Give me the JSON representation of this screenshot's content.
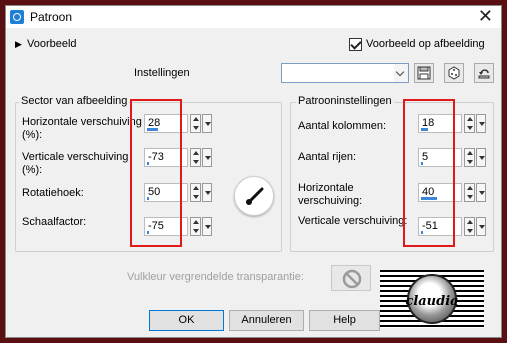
{
  "window": {
    "title": "Patroon"
  },
  "preview": {
    "label": "Voorbeeld",
    "checkbox_label": "Voorbeeld op afbeelding",
    "checked": true
  },
  "settings": {
    "label": "Instellingen",
    "preset_value": ""
  },
  "sector": {
    "title": "Sector van afbeelding",
    "fields": [
      {
        "label": "Horizontale verschuiving (%):",
        "value": "28",
        "level": 28
      },
      {
        "label": "Verticale verschuiving (%):",
        "value": "-73",
        "level": 5
      },
      {
        "label": "Rotatiehoek:",
        "value": "50",
        "level": 5
      },
      {
        "label": "Schaalfactor:",
        "value": "-75",
        "level": 5
      }
    ]
  },
  "pattern": {
    "title": "Patrooninstellingen",
    "fields": [
      {
        "label": "Aantal kolommen:",
        "value": "18",
        "level": 18
      },
      {
        "label": "Aantal rijen:",
        "value": "5",
        "level": 5
      },
      {
        "label": "Horizontale verschuiving:",
        "value": "40",
        "level": 40
      },
      {
        "label": "Verticale verschuiving:",
        "value": "-51",
        "level": 5
      }
    ]
  },
  "transparency": {
    "label": "Vulkleur vergrendelde transparantie:"
  },
  "buttons": {
    "ok": "OK",
    "cancel": "Annuleren",
    "help": "Help"
  },
  "logo": {
    "text": "claudia"
  },
  "colors": {
    "highlight": "#e01919",
    "accent": "#3d87d8",
    "frame": "#5a1010"
  }
}
